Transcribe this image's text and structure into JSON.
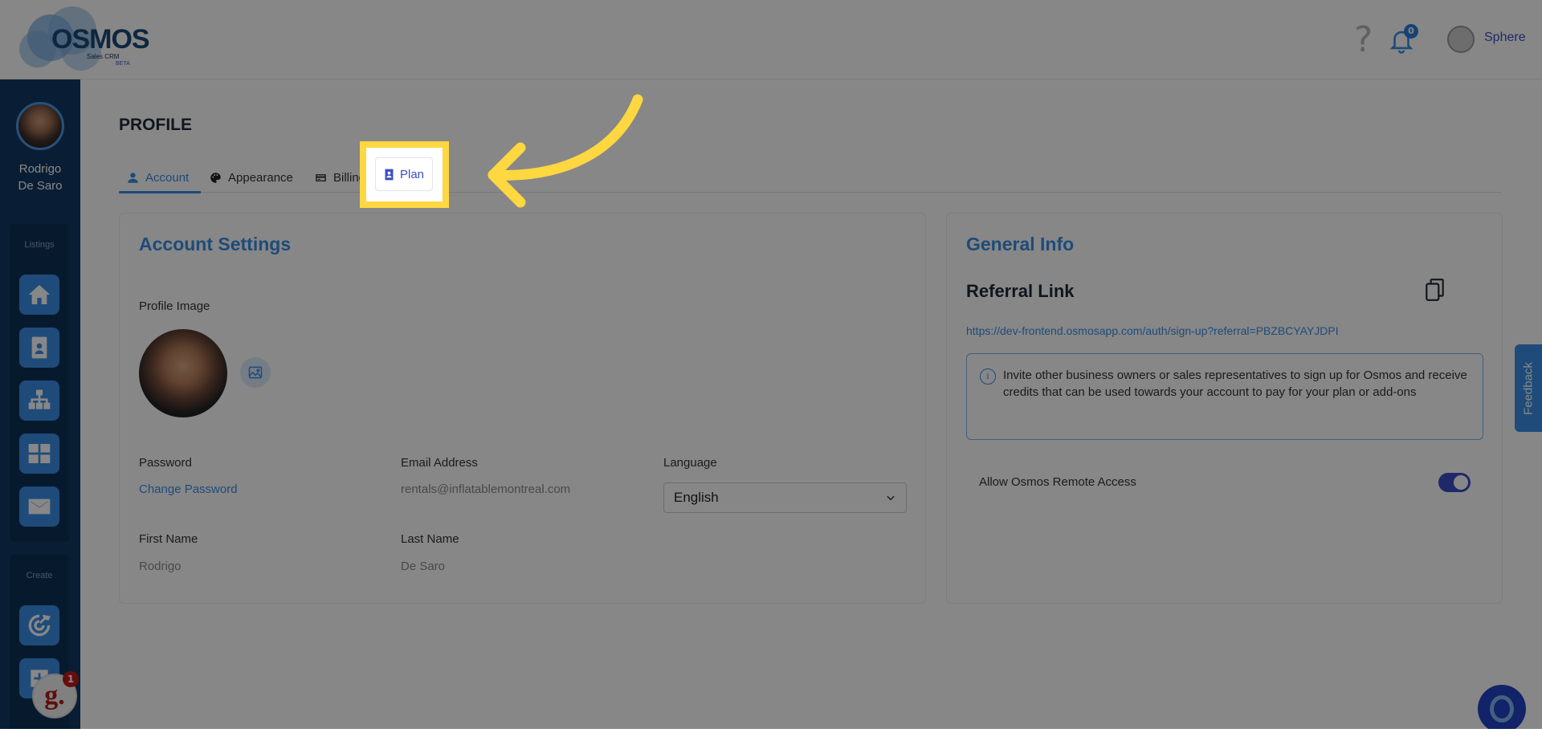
{
  "header": {
    "logo_word": "OSMOS",
    "logo_sub": "Sales CRM",
    "logo_beta": "BETA",
    "help_icon": "question-icon",
    "notifications_count": "0",
    "company_name": "Sphere"
  },
  "sidebar": {
    "user_first_name": "Rodrigo",
    "user_last_name": "De Saro",
    "section_listings": "Listings",
    "section_create": "Create",
    "listing_icons": [
      "home-icon",
      "contact-card-icon",
      "org-chart-icon",
      "dashboard-grid-icon",
      "mail-icon"
    ],
    "create_icons": [
      "target-icon",
      "add-item-icon"
    ]
  },
  "page": {
    "title": "PROFILE",
    "tabs": [
      "Account",
      "Appearance",
      "Billing",
      "Plan"
    ],
    "active_tab": "Account",
    "highlighted_tab": "Plan"
  },
  "account_settings": {
    "title": "Account Settings",
    "profile_image_label": "Profile Image",
    "password_label": "Password",
    "change_password_link": "Change Password",
    "email_label": "Email Address",
    "email_value": "rentals@inflatablemontreal.com",
    "language_label": "Language",
    "language_value": "English",
    "first_name_label": "First Name",
    "first_name_value": "Rodrigo",
    "last_name_label": "Last Name",
    "last_name_value": "De Saro"
  },
  "general_info": {
    "title": "General Info",
    "referral_title": "Referral Link",
    "referral_url": "https://dev-frontend.osmosapp.com/auth/sign-up?referral=PBZBCYAYJDPI",
    "info_text": "Invite other business owners or sales representatives to sign up for Osmos and receive credits that can be used towards your account to pay for your plan or add-ons",
    "remote_access_label": "Allow Osmos Remote Access",
    "remote_access_enabled": true
  },
  "widgets": {
    "feedback_label": "Feedback",
    "g_letter": "g.",
    "g_badge": "1"
  },
  "colors": {
    "accent": "#3a8ee6",
    "sidebar": "#123a62",
    "highlight": "#ffd740",
    "toggle": "#3b4ec6"
  }
}
